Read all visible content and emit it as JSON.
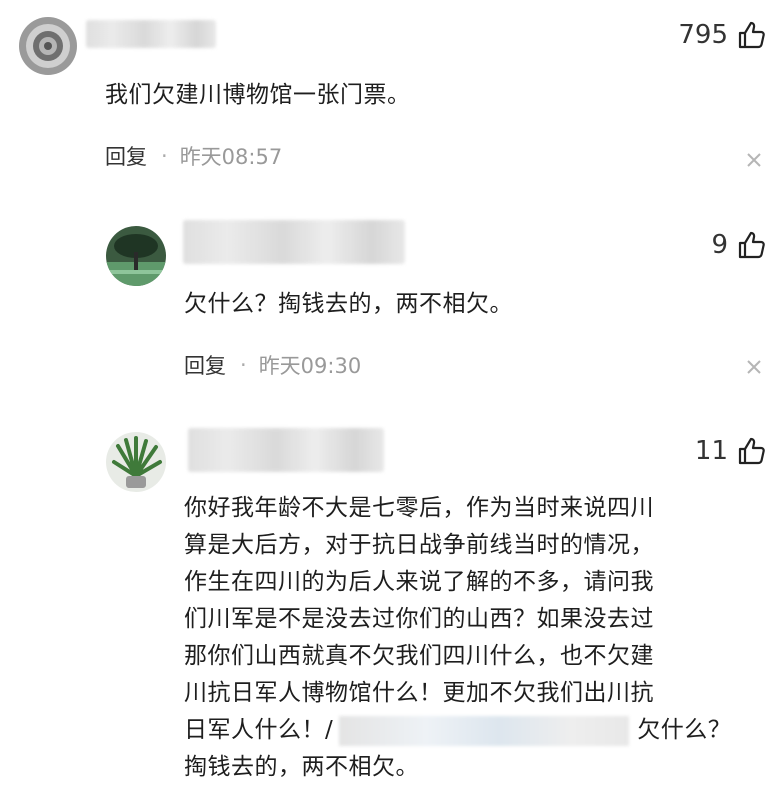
{
  "comments": [
    {
      "likes": "795",
      "text": "我们欠建川博物馆一张门票。",
      "reply_label": "回复",
      "separator": "·",
      "time": "昨天08:57"
    },
    {
      "likes": "9",
      "text": "欠什么？掏钱去的，两不相欠。",
      "reply_label": "回复",
      "separator": "·",
      "time": "昨天09:30"
    },
    {
      "likes": "11",
      "lines": [
        "你好我年龄不大是七零后，作为当时来说四川",
        "算是大后方，对于抗日战争前线当时的情况，",
        "作生在四川的为后人来说了解的不多，请问我",
        "们川军是不是没去过你们的山西？如果没去过",
        "那你们山西就真不欠我们四川什么，也不欠建",
        "川抗日军人博物馆什么！更加不欠我们出川抗"
      ],
      "line7_prefix": "日军人什么！/",
      "line7_suffix": "欠什么？",
      "line8": "掏钱去的，两不相欠。"
    }
  ],
  "icons": {
    "like": "thumbs-up-icon",
    "close": "close-icon"
  }
}
